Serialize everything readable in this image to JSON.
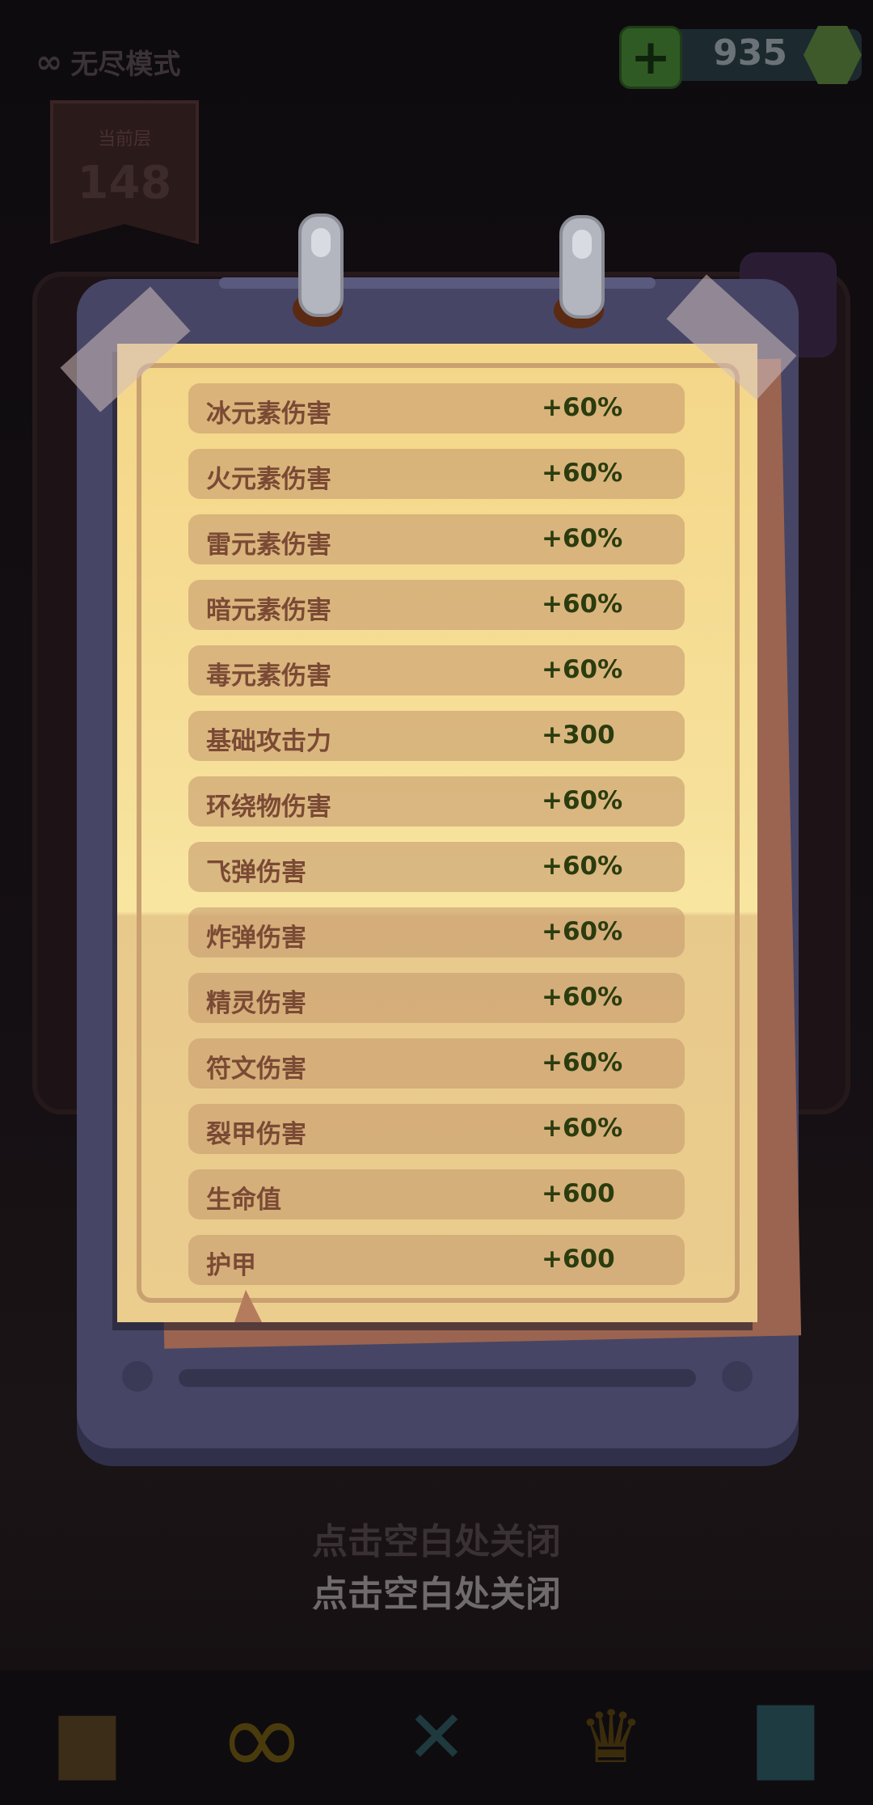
{
  "background": {
    "mode_label": "无尽模式",
    "level_banner_label": "当前层",
    "level_number": "148",
    "currency_amount": "935",
    "bottom_nav_icons": [
      "shop-icon",
      "infinity-icon",
      "crossed-swords-icon",
      "trophy-icon",
      "chest-icon"
    ]
  },
  "dialog": {
    "stats": [
      {
        "name": "冰元素伤害",
        "value": "+60%"
      },
      {
        "name": "火元素伤害",
        "value": "+60%"
      },
      {
        "name": "雷元素伤害",
        "value": "+60%"
      },
      {
        "name": "暗元素伤害",
        "value": "+60%"
      },
      {
        "name": "毒元素伤害",
        "value": "+60%"
      },
      {
        "name": "基础攻击力",
        "value": "+300"
      },
      {
        "name": "环绕物伤害",
        "value": "+60%"
      },
      {
        "name": "飞弹伤害",
        "value": "+60%"
      },
      {
        "name": "炸弹伤害",
        "value": "+60%"
      },
      {
        "name": "精灵伤害",
        "value": "+60%"
      },
      {
        "name": "符文伤害",
        "value": "+60%"
      },
      {
        "name": "裂甲伤害",
        "value": "+60%"
      },
      {
        "name": "生命值",
        "value": "+600"
      },
      {
        "name": "护甲",
        "value": "+600"
      }
    ],
    "close_hint": "点击空白处关闭",
    "close_hint_shadow": "点击空白处关闭"
  },
  "colors": {
    "clipboard": "#464565",
    "paper": "#f6e09a",
    "row_bg": "#d4ad78",
    "stat_name": "#7a4a35",
    "stat_value": "#2b3c0e"
  }
}
